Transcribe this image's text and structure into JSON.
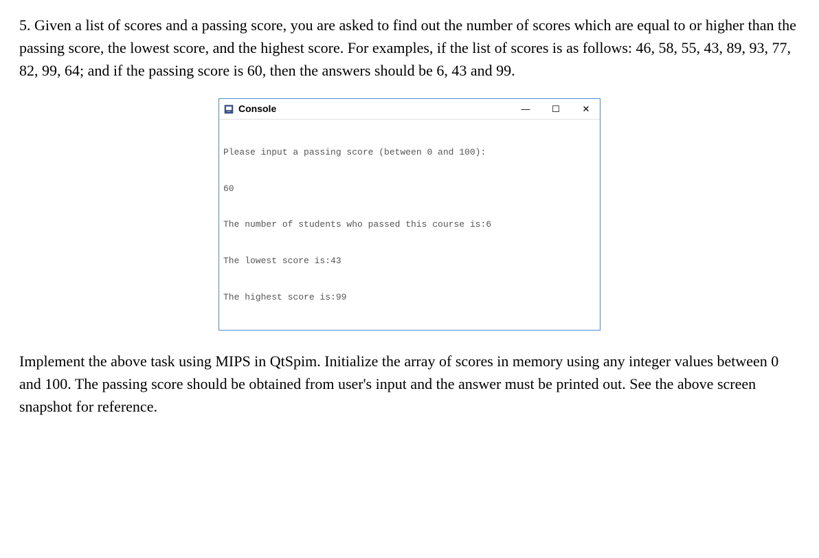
{
  "problem": {
    "number": "5.",
    "text": "Given a list of scores and a passing score, you are asked to find out the number of scores which are equal to or higher than the passing score, the lowest score, and the highest score. For examples, if the list of scores is as follows: 46, 58, 55, 43, 89, 93, 77, 82, 99, 64; and if the passing score is 60, then the answers should be 6, 43 and 99."
  },
  "console": {
    "title": "Console",
    "lines": {
      "l0": "Please input a passing score (between 0 and 100):",
      "l1": "60",
      "l2": "The number of students who passed this course is:6",
      "l3": "The lowest score is:43",
      "l4": "The highest score is:99"
    },
    "controls": {
      "minimize": "—",
      "maximize": "☐",
      "close": "✕"
    }
  },
  "instruction": {
    "text": "Implement the above task using MIPS in QtSpim. Initialize the array of scores in memory using any integer values between 0 and 100. The passing score should be obtained from user's input and the answer must be printed out. See the above screen snapshot for reference."
  }
}
